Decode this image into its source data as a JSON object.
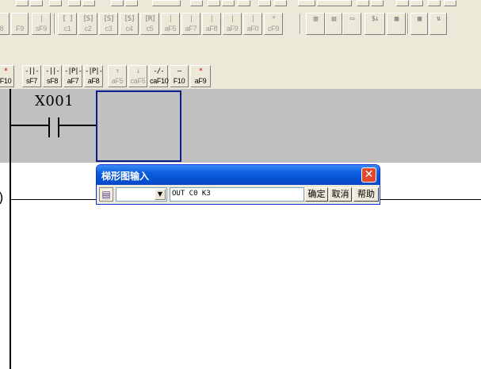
{
  "toolbar_row1": [
    {
      "glyph": "",
      "label": "8",
      "gray": true
    },
    {
      "glyph": "",
      "label": "F9",
      "gray": true
    },
    {
      "glyph": "|",
      "label": "sF9",
      "gray": true
    },
    {
      "glyph": "[ ]",
      "label": "c1",
      "gray": true
    },
    {
      "glyph": "[S]",
      "label": "c2",
      "gray": true
    },
    {
      "glyph": "[S]",
      "label": "c3",
      "gray": true
    },
    {
      "glyph": "[S]",
      "label": "c4",
      "gray": true
    },
    {
      "glyph": "[R]",
      "label": "c5",
      "gray": true
    },
    {
      "glyph": "|",
      "label": "aF5",
      "gray": true
    },
    {
      "glyph": "|",
      "label": "aF7",
      "gray": true
    },
    {
      "glyph": "|",
      "label": "aF8",
      "gray": true
    },
    {
      "glyph": "|",
      "label": "aF9",
      "gray": true
    },
    {
      "glyph": "|",
      "label": "aF0",
      "gray": true
    },
    {
      "glyph": "*",
      "label": "cF9",
      "gray": true
    }
  ],
  "toolbar_row2": [
    {
      "glyph": "*",
      "label": "F10",
      "red": true
    },
    {
      "glyph": "-||-",
      "label": "sF7"
    },
    {
      "glyph": "-||-",
      "label": "sF8"
    },
    {
      "glyph": "-|P|-",
      "label": "aF7"
    },
    {
      "glyph": "-|P|-",
      "label": "aF8"
    },
    {
      "glyph": "↑",
      "label": "aF5",
      "gray": true
    },
    {
      "glyph": "↓",
      "label": "caF5",
      "gray": true
    },
    {
      "glyph": "-/-",
      "label": "caF10"
    },
    {
      "glyph": "—",
      "label": "F10"
    },
    {
      "glyph": "*",
      "label": "aF9",
      "red": true
    }
  ],
  "ladder": {
    "contact_label": "X001",
    "coil_paren": ")"
  },
  "dialog": {
    "title": "梯形图输入",
    "close_glyph": "✕",
    "book_glyph": "▤",
    "select_arrow": "▼",
    "input_value": "OUT C0 K3",
    "confirm_label": "确定",
    "cancel_label": "取消",
    "help_label": "帮助"
  }
}
